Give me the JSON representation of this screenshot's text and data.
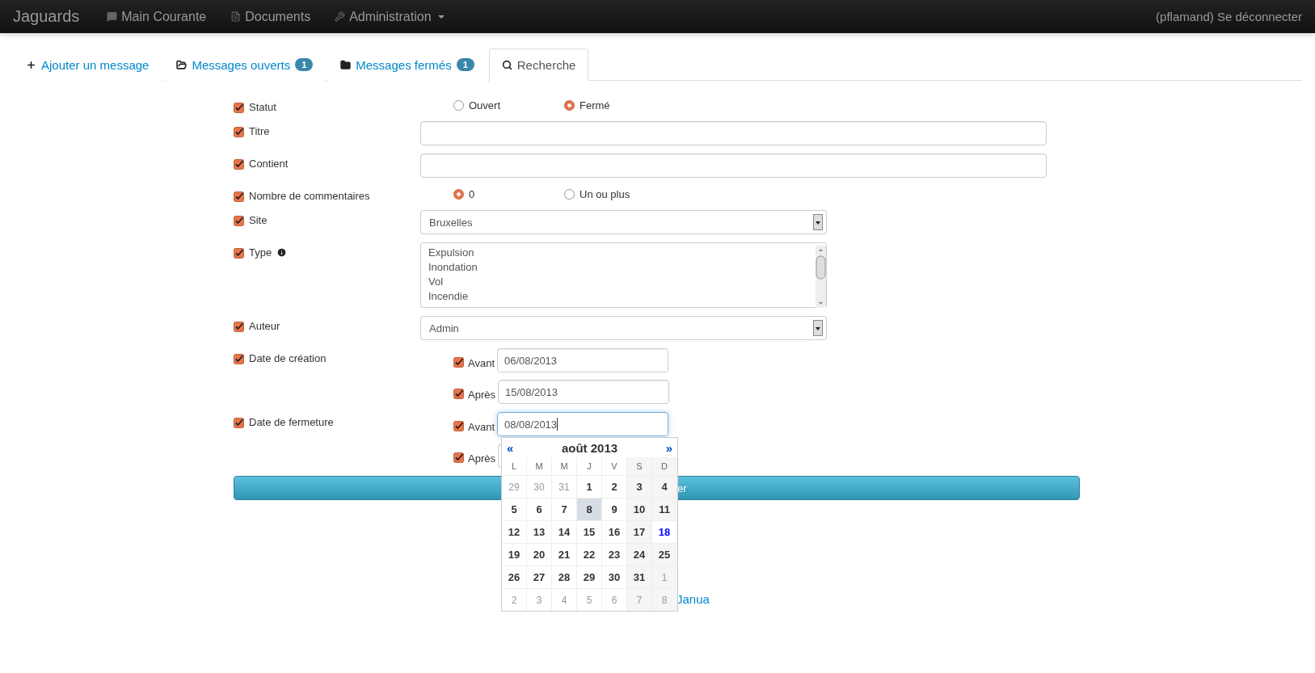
{
  "navbar": {
    "brand": "Jaguards",
    "items": [
      {
        "label": "Main Courante",
        "dropdown": false
      },
      {
        "label": "Documents",
        "dropdown": false
      },
      {
        "label": "Administration",
        "dropdown": true
      }
    ],
    "user": "(pflamand) Se déconnecter"
  },
  "tabs": [
    {
      "label": "Ajouter un message",
      "selected": false
    },
    {
      "label": "Messages ouverts",
      "badge": "1",
      "selected": false
    },
    {
      "label": "Messages fermés",
      "badge": "1",
      "selected": false
    },
    {
      "label": "Recherche",
      "selected": true
    }
  ],
  "fields": [
    {
      "kind": "radio",
      "label": "Statut",
      "checked": true,
      "help": false,
      "options": [
        {
          "label": "Ouvert",
          "selected": false
        },
        {
          "label": "Fermé",
          "selected": true
        }
      ]
    },
    {
      "kind": "text",
      "label": "Titre",
      "checked": true,
      "help": false
    },
    {
      "kind": "text",
      "label": "Contient",
      "checked": true,
      "help": false
    },
    {
      "kind": "radio",
      "label": "Nombre de commentaires",
      "checked": true,
      "help": false,
      "options": [
        {
          "label": "0",
          "selected": true
        },
        {
          "label": "Un ou plus",
          "selected": false
        }
      ]
    },
    {
      "kind": "select",
      "label": "Site",
      "checked": true,
      "help": false,
      "value": "Bruxelles"
    },
    {
      "kind": "list",
      "label": "Type",
      "checked": true,
      "help": true,
      "items": [
        "Expulsion",
        "Inondation",
        "Vol",
        "Incendie"
      ]
    },
    {
      "kind": "select",
      "label": "Auteur",
      "checked": true,
      "help": false,
      "value": "Admin"
    },
    {
      "kind": "dates",
      "label": "Date de création",
      "checked": true,
      "help": false,
      "bounds": [
        {
          "label": "Avant",
          "checked": true,
          "value": "06/08/2013",
          "focused": false
        },
        {
          "label": "Après",
          "checked": true,
          "value": "15/08/2013",
          "focused": false
        }
      ]
    },
    {
      "kind": "dates",
      "label": "Date de fermeture",
      "checked": true,
      "help": false,
      "bounds": [
        {
          "label": "Avant",
          "checked": true,
          "value": "08/08/2013",
          "focused": true
        },
        {
          "label": "Après",
          "checked": true,
          "focused": false
        }
      ]
    }
  ],
  "calendar": {
    "prev": "«",
    "title": "août 2013",
    "next": "»",
    "weekdays": [
      "L",
      "M",
      "M",
      "J",
      "V",
      "S",
      "D"
    ],
    "weeks": [
      [
        {
          "day": "29",
          "muted": true,
          "selected": false,
          "today": false
        },
        {
          "day": "30",
          "muted": true,
          "selected": false,
          "today": false
        },
        {
          "day": "31",
          "muted": true,
          "selected": false,
          "today": false
        },
        {
          "day": "1",
          "muted": false,
          "selected": false,
          "today": false
        },
        {
          "day": "2",
          "muted": false,
          "selected": false,
          "today": false
        },
        {
          "day": "3",
          "muted": false,
          "selected": false,
          "today": false
        },
        {
          "day": "4",
          "muted": false,
          "selected": false,
          "today": false
        }
      ],
      [
        {
          "day": "5",
          "muted": false,
          "selected": false,
          "today": false
        },
        {
          "day": "6",
          "muted": false,
          "selected": false,
          "today": false
        },
        {
          "day": "7",
          "muted": false,
          "selected": false,
          "today": false
        },
        {
          "day": "8",
          "muted": false,
          "selected": true,
          "today": false
        },
        {
          "day": "9",
          "muted": false,
          "selected": false,
          "today": false
        },
        {
          "day": "10",
          "muted": false,
          "selected": false,
          "today": false
        },
        {
          "day": "11",
          "muted": false,
          "selected": false,
          "today": false
        }
      ],
      [
        {
          "day": "12",
          "muted": false,
          "selected": false,
          "today": false
        },
        {
          "day": "13",
          "muted": false,
          "selected": false,
          "today": false
        },
        {
          "day": "14",
          "muted": false,
          "selected": false,
          "today": false
        },
        {
          "day": "15",
          "muted": false,
          "selected": false,
          "today": false
        },
        {
          "day": "16",
          "muted": false,
          "selected": false,
          "today": false
        },
        {
          "day": "17",
          "muted": false,
          "selected": false,
          "today": false
        },
        {
          "day": "18",
          "muted": false,
          "selected": false,
          "today": true
        }
      ],
      [
        {
          "day": "19",
          "muted": false,
          "selected": false,
          "today": false
        },
        {
          "day": "20",
          "muted": false,
          "selected": false,
          "today": false
        },
        {
          "day": "21",
          "muted": false,
          "selected": false,
          "today": false
        },
        {
          "day": "22",
          "muted": false,
          "selected": false,
          "today": false
        },
        {
          "day": "23",
          "muted": false,
          "selected": false,
          "today": false
        },
        {
          "day": "24",
          "muted": false,
          "selected": false,
          "today": false
        },
        {
          "day": "25",
          "muted": false,
          "selected": false,
          "today": false
        }
      ],
      [
        {
          "day": "26",
          "muted": false,
          "selected": false,
          "today": false
        },
        {
          "day": "27",
          "muted": false,
          "selected": false,
          "today": false
        },
        {
          "day": "28",
          "muted": false,
          "selected": false,
          "today": false
        },
        {
          "day": "29",
          "muted": false,
          "selected": false,
          "today": false
        },
        {
          "day": "30",
          "muted": false,
          "selected": false,
          "today": false
        },
        {
          "day": "31",
          "muted": false,
          "selected": false,
          "today": false
        },
        {
          "day": "1",
          "muted": true,
          "selected": false,
          "today": false
        }
      ],
      [
        {
          "day": "2",
          "muted": true,
          "selected": false,
          "today": false
        },
        {
          "day": "3",
          "muted": true,
          "selected": false,
          "today": false
        },
        {
          "day": "4",
          "muted": true,
          "selected": false,
          "today": false
        },
        {
          "day": "5",
          "muted": true,
          "selected": false,
          "today": false
        },
        {
          "day": "6",
          "muted": true,
          "selected": false,
          "today": false
        },
        {
          "day": "7",
          "muted": true,
          "selected": false,
          "today": false
        },
        {
          "day": "8",
          "muted": true,
          "selected": false,
          "today": false
        }
      ]
    ]
  },
  "submit": {
    "label": "er"
  },
  "footer": {
    "link": "Janua"
  }
}
